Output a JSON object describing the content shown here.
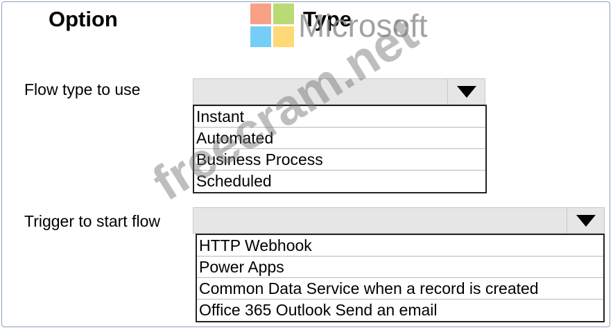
{
  "headers": {
    "option": "Option",
    "type": "Type"
  },
  "rows": [
    {
      "label": "Flow type to use",
      "selected": "",
      "options": [
        "Instant",
        "Automated",
        "Business Process",
        "Scheduled"
      ]
    },
    {
      "label": "Trigger to start flow",
      "selected": "",
      "options": [
        "HTTP Webhook",
        "Power Apps",
        "Common Data Service when a record is created",
        "Office 365 Outlook Send an email"
      ]
    }
  ],
  "overlays": {
    "logo_text": "Microsoft",
    "watermark": "freecram.net",
    "logo_colors": [
      "#f35325",
      "#81bc06",
      "#05a6f0",
      "#ffba08"
    ]
  }
}
